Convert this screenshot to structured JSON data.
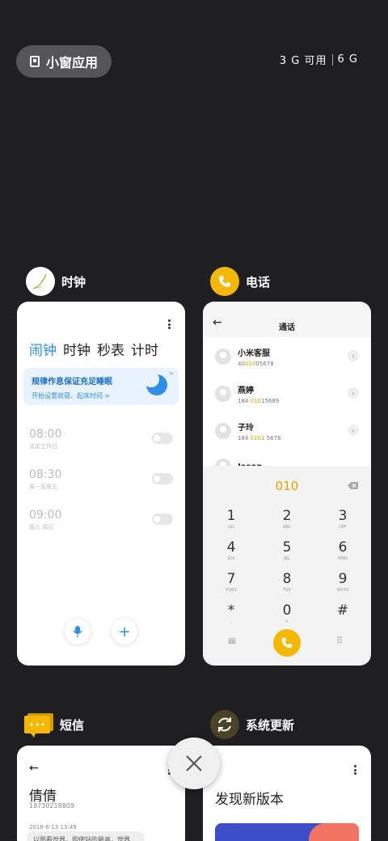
{
  "top": {
    "small_window_label": "小窗应用",
    "memory_available": "3 G 可用",
    "memory_total": "6 G"
  },
  "clock": {
    "app_name": "时钟",
    "tabs": [
      "闹钟",
      "时钟",
      "秒表",
      "计时"
    ],
    "banner_title": "规律作息保证充足睡眠",
    "banner_sub": "开始设置就寝、起床时间 >",
    "alarms": [
      {
        "time": "08:00",
        "repeat": "法定工作日"
      },
      {
        "time": "08:30",
        "repeat": "周一至周五"
      },
      {
        "time": "09:00",
        "repeat": "周六 周日"
      }
    ]
  },
  "phone": {
    "app_name": "电话",
    "title": "通话",
    "contacts": [
      {
        "name": "小米客服",
        "num_pre": "40",
        "num_hl": "010",
        "num_post": "05678"
      },
      {
        "name": "燕婷",
        "num_pre": "184 ",
        "num_hl": "010",
        "num_post": "15689"
      },
      {
        "name": "子玲",
        "num_pre": "184 ",
        "num_hl": "0101",
        "num_post": " 5678"
      },
      {
        "name": "Jason",
        "num_pre": "",
        "num_hl": "",
        "num_post": ""
      }
    ],
    "dial_input": "010",
    "keys": [
      {
        "d": "1",
        "l": "GD"
      },
      {
        "d": "2",
        "l": "ABC"
      },
      {
        "d": "3",
        "l": "DEF"
      },
      {
        "d": "4",
        "l": "GHI"
      },
      {
        "d": "5",
        "l": "JKL"
      },
      {
        "d": "6",
        "l": "MNO"
      },
      {
        "d": "7",
        "l": "PQRS"
      },
      {
        "d": "8",
        "l": "TUV"
      },
      {
        "d": "9",
        "l": "WXYZ"
      },
      {
        "d": "*",
        "l": ","
      },
      {
        "d": "0",
        "l": "+"
      },
      {
        "d": "#",
        "l": ""
      }
    ]
  },
  "sms": {
    "app_name": "短信",
    "contact_name": "倩倩",
    "contact_number": "18730218809",
    "date": "2016-6-13 13:49",
    "message_preview": "以图看世界，即使站的最高，世界"
  },
  "update": {
    "app_name": "系统更新",
    "heading": "发现新版本"
  },
  "colors": {
    "accent_blue": "#2f8fe6",
    "phone_yellow": "#f5b800",
    "bg": "#1f1f22"
  }
}
